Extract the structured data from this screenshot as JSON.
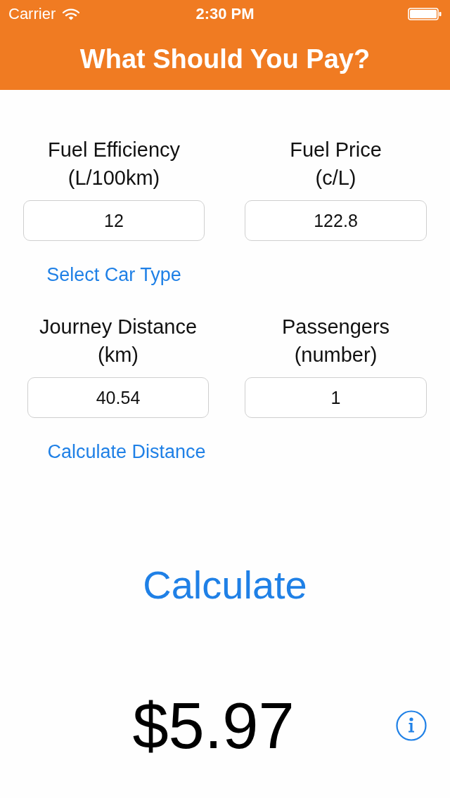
{
  "status_bar": {
    "carrier": "Carrier",
    "time": "2:30 PM"
  },
  "title": "What Should You Pay?",
  "fields": [
    {
      "label": "Fuel Efficiency",
      "unit": "(L/100km)",
      "value": "12",
      "link": "Select Car Type"
    },
    {
      "label": "Fuel Price",
      "unit": "(c/L)",
      "value": "122.8"
    },
    {
      "label": "Journey Distance",
      "unit": "(km)",
      "value": "40.54",
      "link": "Calculate Distance"
    },
    {
      "label": "Passengers",
      "unit": "(number)",
      "value": "1"
    }
  ],
  "calculate_button": "Calculate",
  "result": "$5.97"
}
